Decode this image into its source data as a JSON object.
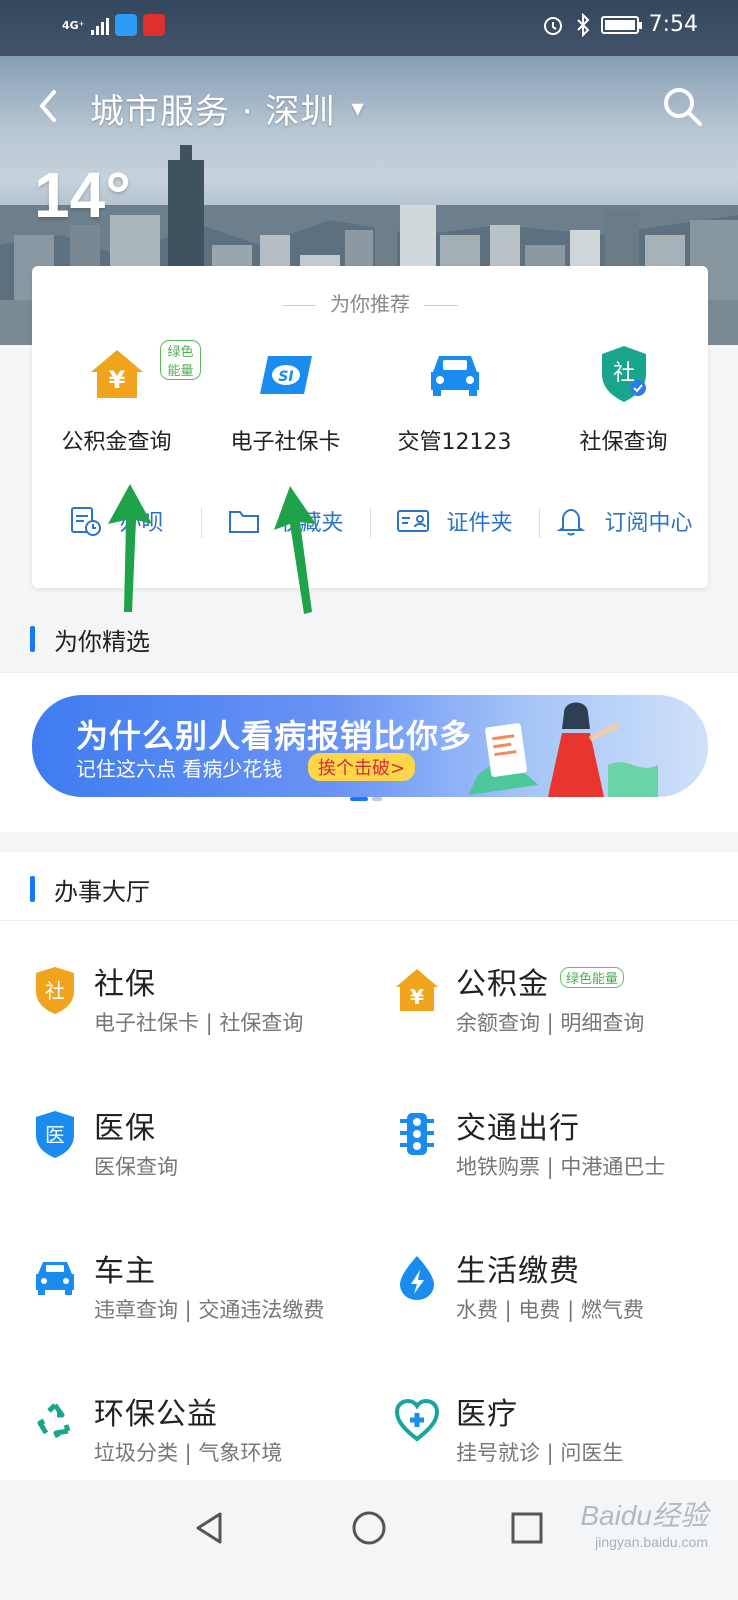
{
  "status_bar": {
    "signal": "4G⁺",
    "time": "7:54"
  },
  "header": {
    "title": "城市服务 · 深圳",
    "temperature": "14°"
  },
  "recommend": {
    "heading": "为你推荐",
    "items": [
      {
        "label": "公积金查询",
        "tag": "绿色能量",
        "icon": "housing-fund-icon"
      },
      {
        "label": "电子社保卡",
        "icon": "social-security-card-icon"
      },
      {
        "label": "交管12123",
        "icon": "car-icon"
      },
      {
        "label": "社保查询",
        "icon": "social-shield-icon"
      }
    ],
    "links": [
      {
        "label": "办呗",
        "icon": "calendar-clock-icon"
      },
      {
        "label": "收藏夹",
        "icon": "folder-icon"
      },
      {
        "label": "证件夹",
        "icon": "id-card-icon"
      },
      {
        "label": "订阅中心",
        "icon": "bell-icon"
      }
    ]
  },
  "featured": {
    "heading": "为你精选",
    "banner_title": "为什么别人看病报销比你多",
    "banner_subtitle": "记住这六点 看病少花钱",
    "banner_button": "挨个击破>"
  },
  "hall": {
    "heading": "办事大厅",
    "services": [
      {
        "name": "社保",
        "sub": "电子社保卡 | 社保查询",
        "icon": "social-security-icon"
      },
      {
        "name": "公积金",
        "sub": "余额查询 | 明细查询",
        "tag": "绿色能量",
        "icon": "housing-fund-icon"
      },
      {
        "name": "医保",
        "sub": "医保查询",
        "icon": "medical-insurance-icon"
      },
      {
        "name": "交通出行",
        "sub": "地铁购票 | 中港通巴士",
        "icon": "traffic-light-icon"
      },
      {
        "name": "车主",
        "sub": "违章查询 | 交通违法缴费",
        "icon": "car-icon"
      },
      {
        "name": "生活缴费",
        "sub": "水费 | 电费 | 燃气费",
        "icon": "utility-bolt-icon"
      },
      {
        "name": "环保公益",
        "sub": "垃圾分类 | 气象环境",
        "icon": "recycle-icon"
      },
      {
        "name": "医疗",
        "sub": "挂号就诊 | 问医生",
        "icon": "stethoscope-icon"
      }
    ]
  },
  "watermark": {
    "text": "Baidu经验",
    "sub": "jingyan.baidu.com"
  },
  "colors": {
    "accent": "#1677ff",
    "fund_orange": "#f0a41e",
    "green_tag": "#4caf50",
    "arrow_green": "#1fa34a"
  }
}
